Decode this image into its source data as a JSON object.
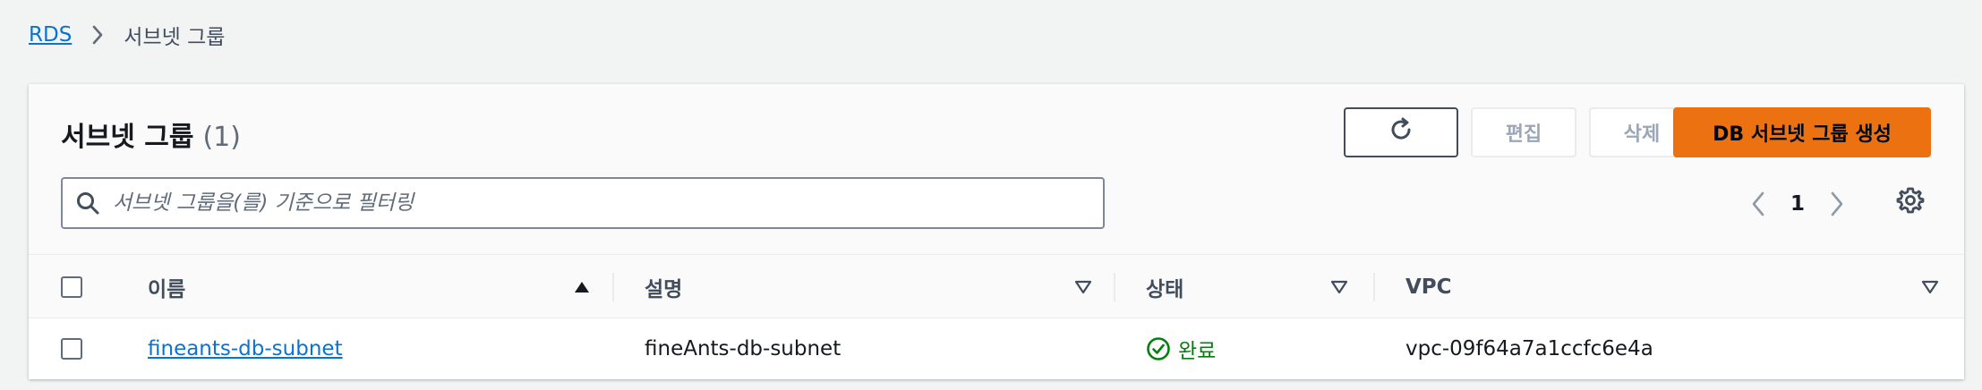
{
  "breadcrumb": {
    "root": "RDS",
    "current": "서브넷 그룹"
  },
  "panel": {
    "title": "서브넷 그룹",
    "count": "(1)",
    "buttons": {
      "edit": "편집",
      "delete": "삭제",
      "create": "DB 서브넷 그룹 생성"
    },
    "search": {
      "placeholder": "서브넷 그룹을(를) 기준으로 필터링",
      "value": ""
    },
    "pagination": {
      "page": "1"
    }
  },
  "table": {
    "columns": [
      "이름",
      "설명",
      "상태",
      "VPC"
    ],
    "rows": [
      {
        "name": "fineants-db-subnet",
        "description": "fineAnts-db-subnet",
        "status": "완료",
        "vpc": "vpc-09f64a7a1ccfc6e4a"
      }
    ]
  },
  "colors": {
    "link": "#0972d3",
    "primary": "#ec7211",
    "success": "#037f0c"
  }
}
